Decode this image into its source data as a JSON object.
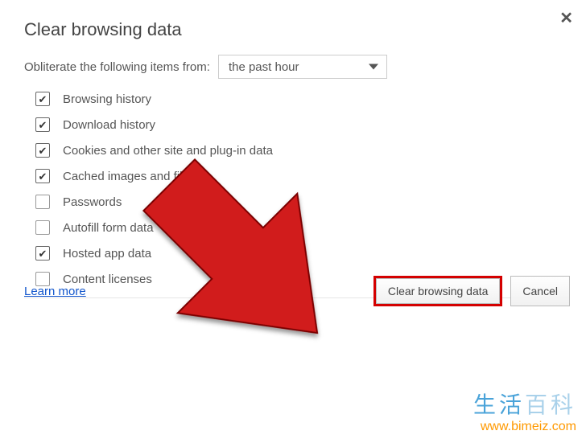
{
  "dialog": {
    "title": "Clear browsing data",
    "obliterate_label": "Obliterate the following items from:",
    "time_range_selected": "the past hour",
    "options": [
      {
        "label": "Browsing history",
        "checked": true
      },
      {
        "label": "Download history",
        "checked": true
      },
      {
        "label": "Cookies and other site and plug-in data",
        "checked": true
      },
      {
        "label": "Cached images and files",
        "checked": true
      },
      {
        "label": "Passwords",
        "checked": false
      },
      {
        "label": "Autofill form data",
        "checked": false
      },
      {
        "label": "Hosted app data",
        "checked": true
      },
      {
        "label": "Content licenses",
        "checked": false
      }
    ],
    "learn_more": "Learn more",
    "clear_button": "Clear browsing data",
    "cancel_button": "Cancel"
  },
  "watermark": {
    "text_cn_1": "生活",
    "text_cn_2": "百科",
    "url": "www.bimeiz.com"
  }
}
